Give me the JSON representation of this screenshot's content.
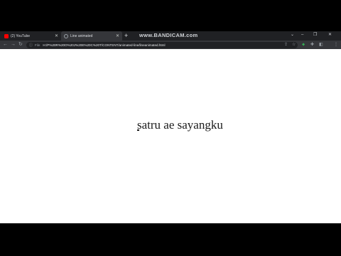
{
  "browser": {
    "tabs": [
      {
        "label": "(2) YouTube",
        "icon": "youtube-icon"
      },
      {
        "label": "Line animated",
        "icon": "globe-icon"
      }
    ],
    "new_tab_glyph": "+",
    "watermark": "www.BANDICAM.com",
    "window_controls": {
      "dropdown": "⌄",
      "minimize": "–",
      "maximize": "❐",
      "close": "✕"
    },
    "address": {
      "info_glyph": "ⓘ",
      "scheme_label": "File",
      "url": "H:/P%20R%20O%20J%20E%20C%20T/CONTENT/animated-line/lineanimated.html"
    },
    "nav": {
      "back": "←",
      "forward": "→",
      "reload": "↻"
    },
    "toolbar_icons": {
      "share": "⇪",
      "star": "☆",
      "extension": "⬥",
      "puzzle": "✚",
      "sidebar": "◧",
      "menu": "⋮"
    }
  },
  "page": {
    "animated_text": "satru ae sayangku"
  },
  "colors": {
    "chrome_dark": "#202124",
    "chrome_tab": "#35363a",
    "page_bg": "#ffffff"
  }
}
